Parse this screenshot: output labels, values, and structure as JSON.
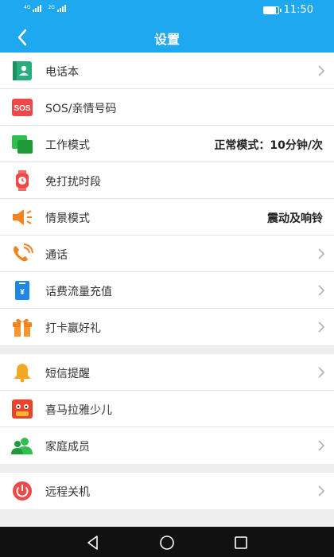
{
  "status_bar": {
    "time": "11:50",
    "sim1": "4G",
    "sim2": "2G"
  },
  "header": {
    "title": "设置"
  },
  "groups": [
    [
      {
        "icon": "contacts-icon",
        "label": "电话本",
        "value": "",
        "chevron": true
      },
      {
        "icon": "sos-icon",
        "icon_text": "SOS",
        "label": "SOS/亲情号码",
        "value": "",
        "chevron": false
      },
      {
        "icon": "work-mode-icon",
        "label": "工作模式",
        "value": "正常模式：10分钟/次",
        "chevron": false
      },
      {
        "icon": "watch-icon",
        "label": "免打扰时段",
        "value": "",
        "chevron": false
      },
      {
        "icon": "speaker-icon",
        "label": "情景模式",
        "value": "震动及响铃",
        "chevron": false
      },
      {
        "icon": "phone-call-icon",
        "label": "通话",
        "value": "",
        "chevron": true
      },
      {
        "icon": "recharge-icon",
        "icon_text": "¥",
        "label": "话费流量充值",
        "value": "",
        "chevron": true
      },
      {
        "icon": "gift-icon",
        "label": "打卡赢好礼",
        "value": "",
        "chevron": true
      }
    ],
    [
      {
        "icon": "bell-icon",
        "label": "短信提醒",
        "value": "",
        "chevron": true
      },
      {
        "icon": "ximalaya-kids-icon",
        "label": "喜马拉雅少儿",
        "value": "",
        "chevron": false
      },
      {
        "icon": "family-members-icon",
        "label": "家庭成员",
        "value": "",
        "chevron": true
      }
    ],
    [
      {
        "icon": "power-icon",
        "label": "远程关机",
        "value": "",
        "chevron": true
      }
    ]
  ],
  "colors": {
    "primary": "#1ea8f0",
    "background": "#eeeeee"
  }
}
